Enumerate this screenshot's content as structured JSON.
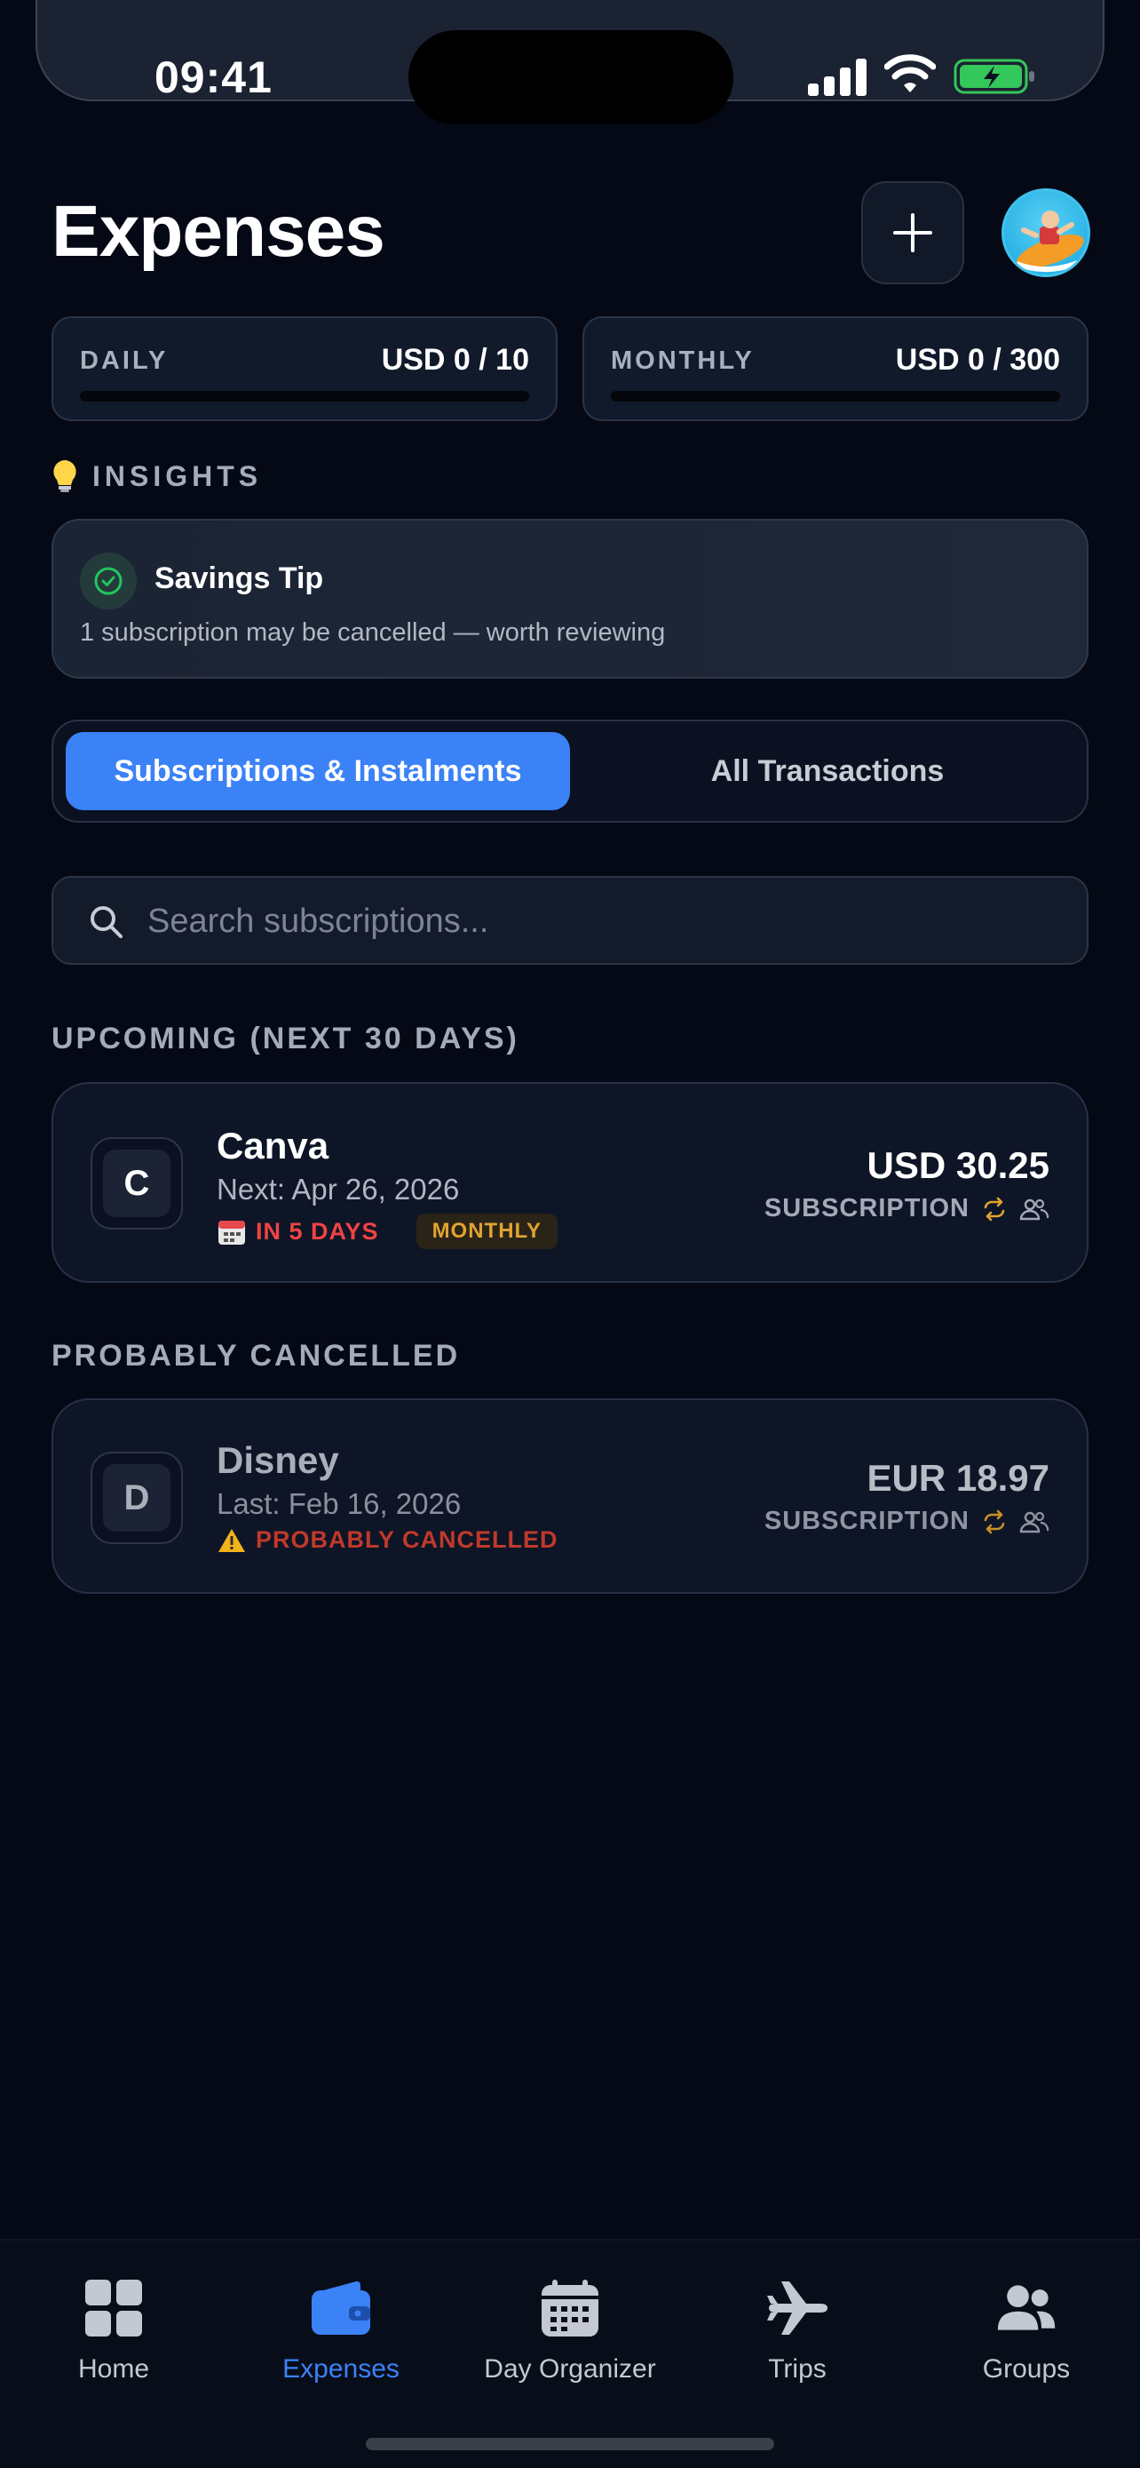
{
  "status_bar": {
    "time": "09:41"
  },
  "header": {
    "title": "Expenses",
    "add_icon": "plus-icon",
    "avatar_icon": "surfer-avatar"
  },
  "budgets": {
    "daily": {
      "label": "DAILY",
      "value": "USD 0 / 10",
      "progress": 0
    },
    "monthly": {
      "label": "MONTHLY",
      "value": "USD 0 / 300",
      "progress": 0
    }
  },
  "insights": {
    "heading": "INSIGHTS",
    "heading_icon": "lightbulb-icon",
    "tip": {
      "title": "Savings Tip",
      "body": "1 subscription may be cancelled — worth reviewing",
      "icon": "check-circle-icon"
    }
  },
  "segments": {
    "active": "Subscriptions & Instalments",
    "inactive": "All Transactions"
  },
  "search": {
    "placeholder": "Search subscriptions...",
    "value": ""
  },
  "sections": {
    "upcoming": {
      "heading": "UPCOMING (NEXT 30 DAYS)",
      "items": [
        {
          "initial": "C",
          "name": "Canva",
          "date": "Next: Apr 26, 2026",
          "flag_icon": "calendar-icon",
          "flag": "IN 5 DAYS",
          "frequency": "MONTHLY",
          "amount": "USD 30.25",
          "type": "SUBSCRIPTION"
        }
      ]
    },
    "cancelled": {
      "heading": "PROBABLY CANCELLED",
      "items": [
        {
          "initial": "D",
          "name": "Disney",
          "date": "Last: Feb 16, 2026",
          "flag_icon": "warning-icon",
          "flag": "PROBABLY CANCELLED",
          "amount": "EUR 18.97",
          "type": "SUBSCRIPTION"
        }
      ]
    }
  },
  "tabs": [
    {
      "label": "Home",
      "icon": "grid-icon",
      "active": false
    },
    {
      "label": "Expenses",
      "icon": "wallet-icon",
      "active": true
    },
    {
      "label": "Day Organizer",
      "icon": "calendar-icon",
      "active": false
    },
    {
      "label": "Trips",
      "icon": "airplane-icon",
      "active": false
    },
    {
      "label": "Groups",
      "icon": "people-icon",
      "active": false
    }
  ],
  "colors": {
    "background": "#050915",
    "accent": "#3b82f6",
    "danger": "#ef4444",
    "cancelled": "#c0392b",
    "monthly_badge": "#e0a331",
    "tip_green": "#22c55e"
  }
}
